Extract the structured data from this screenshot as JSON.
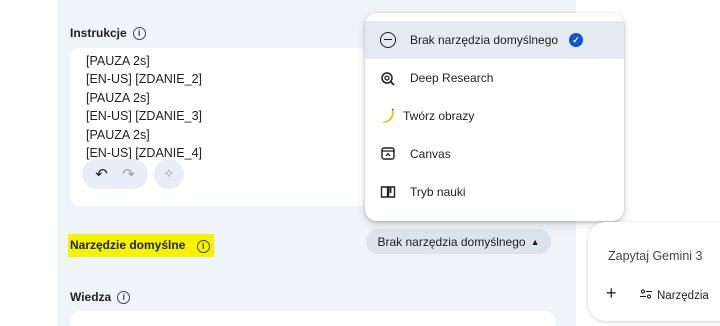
{
  "instructions": {
    "label": "Instrukcje",
    "info_icon": "i",
    "lines": "[PAUZA 2s]\n[EN-US] [ZDANIE_2]\n[PAUZA 2s]\n[EN-US] [ZDANIE_3]\n[PAUZA 2s]\n[EN-US] [ZDANIE_4]"
  },
  "editor_tools": {
    "undo_icon": "undo-icon",
    "redo_icon": "redo-icon",
    "magic_icon": "magic-wand-icon"
  },
  "default_tool": {
    "label": "Narzędzie domyślne",
    "info_icon": "i",
    "highlight_color": "#f5f200",
    "selected_value": "Brak narzędzia domyślnego"
  },
  "knowledge": {
    "label": "Wiedza",
    "info_icon": "i"
  },
  "menu": {
    "items": [
      {
        "label": "Brak narzędzia domyślnego",
        "icon": "minus-circle-icon",
        "selected": true
      },
      {
        "label": "Deep Research",
        "icon": "deep-research-icon",
        "selected": false
      },
      {
        "label": "Twórz obrazy",
        "icon": "banana-icon",
        "selected": false
      },
      {
        "label": "Canvas",
        "icon": "canvas-icon",
        "selected": false
      },
      {
        "label": "Tryb nauki",
        "icon": "book-icon",
        "selected": false
      }
    ]
  },
  "gemini": {
    "placeholder": "Zapytaj Gemini 3",
    "plus": "+",
    "tools_label": "Narzędzia"
  },
  "colors": {
    "panel": "#f0f4f9",
    "accent": "#0b57d0",
    "selected_row": "#e6eaf0"
  }
}
